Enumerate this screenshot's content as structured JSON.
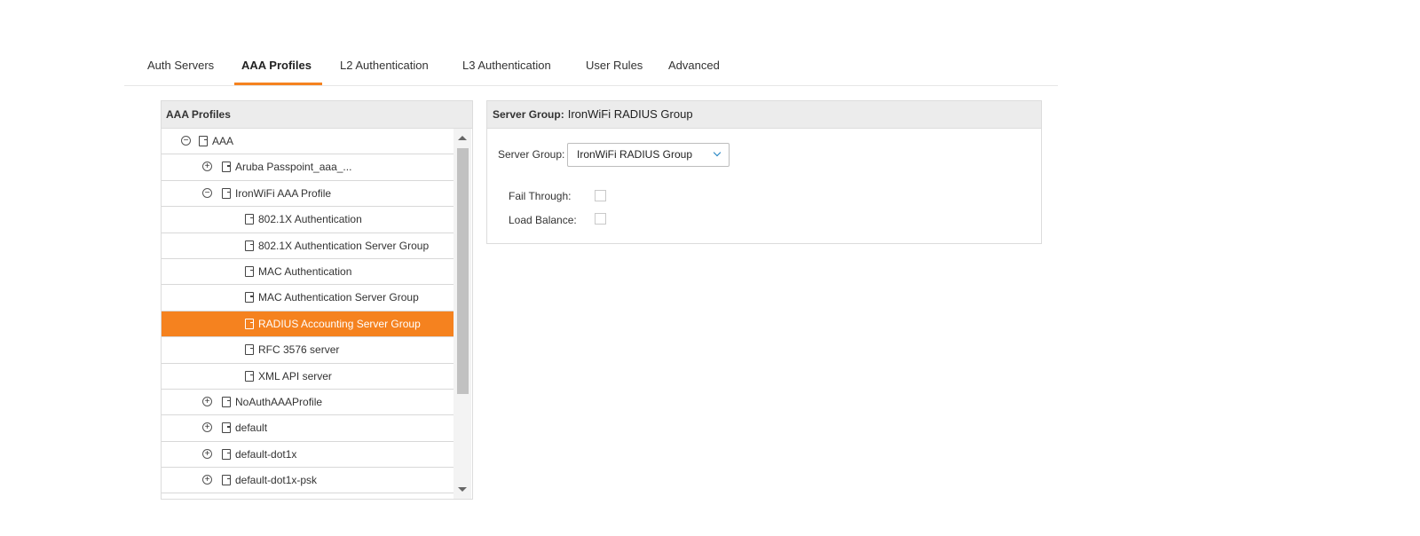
{
  "tabs": [
    {
      "label": "Auth Servers",
      "active": false
    },
    {
      "label": "AAA Profiles",
      "active": true
    },
    {
      "label": "L2 Authentication",
      "active": false
    },
    {
      "label": "L3 Authentication",
      "active": false
    },
    {
      "label": "User Rules",
      "active": false
    },
    {
      "label": "Advanced",
      "active": false
    }
  ],
  "left_panel": {
    "title": "AAA Profiles",
    "tree": [
      {
        "label": "AAA",
        "level": 0,
        "expander": "minus"
      },
      {
        "label": "Aruba Passpoint_aaa_...",
        "level": 1,
        "expander": "plus"
      },
      {
        "label": "IronWiFi AAA Profile",
        "level": 1,
        "expander": "minus"
      },
      {
        "label": "802.1X Authentication",
        "level": 2,
        "expander": "none"
      },
      {
        "label": "802.1X Authentication Server Group",
        "level": 2,
        "expander": "none"
      },
      {
        "label": "MAC Authentication",
        "level": 2,
        "expander": "none"
      },
      {
        "label": "MAC Authentication Server Group",
        "level": 2,
        "expander": "none"
      },
      {
        "label": "RADIUS Accounting Server Group",
        "level": 2,
        "expander": "none",
        "selected": true
      },
      {
        "label": "RFC 3576 server",
        "level": 2,
        "expander": "none"
      },
      {
        "label": "XML API server",
        "level": 2,
        "expander": "none"
      },
      {
        "label": "NoAuthAAAProfile",
        "level": 1,
        "expander": "plus"
      },
      {
        "label": "default",
        "level": 1,
        "expander": "plus"
      },
      {
        "label": "default-dot1x",
        "level": 1,
        "expander": "plus"
      },
      {
        "label": "default-dot1x-psk",
        "level": 1,
        "expander": "plus"
      }
    ]
  },
  "right_panel": {
    "header_label": "Server Group:",
    "header_value": "IronWiFi RADIUS Group",
    "server_group_label": "Server Group:",
    "server_group_value": "IronWiFi RADIUS Group",
    "fail_through_label": "Fail Through:",
    "fail_through_checked": false,
    "load_balance_label": "Load Balance:",
    "load_balance_checked": false
  },
  "colors": {
    "accent": "#f5821f",
    "chevron": "#1a7fc1"
  }
}
